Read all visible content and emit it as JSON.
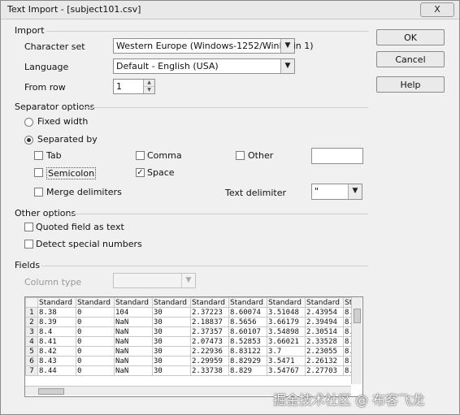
{
  "window": {
    "title": "Text Import - [subject101.csv]",
    "close_label": "X"
  },
  "buttons": {
    "ok": "OK",
    "cancel": "Cancel",
    "help": "Help"
  },
  "import": {
    "section": "Import",
    "charset_label": "Character set",
    "charset_value": "Western Europe (Windows-1252/WinLatin 1)",
    "language_label": "Language",
    "language_value": "Default - English (USA)",
    "from_row_label": "From row",
    "from_row_value": "1"
  },
  "separator": {
    "section": "Separator options",
    "fixed_width": "Fixed width",
    "separated_by": "Separated by",
    "tab": "Tab",
    "comma": "Comma",
    "other": "Other",
    "semicolon": "Semicolon",
    "space": "Space",
    "merge": "Merge delimiters",
    "text_delimiter_label": "Text delimiter",
    "text_delimiter_value": "\""
  },
  "other_options": {
    "section": "Other options",
    "quoted": "Quoted field as text",
    "detect": "Detect special numbers"
  },
  "fields": {
    "section": "Fields",
    "column_type_label": "Column type",
    "column_type_value": "",
    "headers": [
      "Standard",
      "Standard",
      "Standard",
      "Standard",
      "Standard",
      "Standard",
      "Standard",
      "Standard",
      "St"
    ],
    "rows": [
      {
        "n": "1",
        "cells": [
          "8.38",
          "0",
          "104",
          "30",
          "2.37223",
          "8.60074",
          "3.51048",
          "2.43954",
          "8."
        ]
      },
      {
        "n": "2",
        "cells": [
          "8.39",
          "0",
          "NaN",
          "30",
          "2.18837",
          "8.5656",
          "3.66179",
          "2.39494",
          "8."
        ]
      },
      {
        "n": "3",
        "cells": [
          "8.4",
          "0",
          "NaN",
          "30",
          "2.37357",
          "8.60107",
          "3.54898",
          "2.30514",
          "8."
        ]
      },
      {
        "n": "4",
        "cells": [
          "8.41",
          "0",
          "NaN",
          "30",
          "2.07473",
          "8.52853",
          "3.66021",
          "2.33528",
          "8."
        ]
      },
      {
        "n": "5",
        "cells": [
          "8.42",
          "0",
          "NaN",
          "30",
          "2.22936",
          "8.83122",
          "3.7",
          "2.23055",
          "8."
        ]
      },
      {
        "n": "6",
        "cells": [
          "8.43",
          "0",
          "NaN",
          "30",
          "2.29959",
          "8.82929",
          "3.5471",
          "2.26132",
          "8."
        ]
      },
      {
        "n": "7",
        "cells": [
          "8.44",
          "0",
          "NaN",
          "30",
          "2.33738",
          "8.829",
          "3.54767",
          "2.27703",
          "8."
        ]
      }
    ]
  },
  "watermark": "掘金技术社区 @ 布客飞龙"
}
